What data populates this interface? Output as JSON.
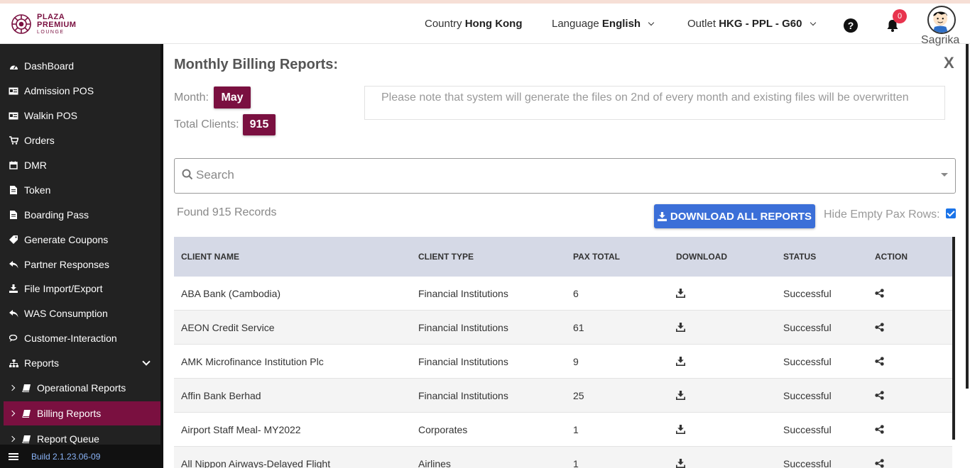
{
  "header": {
    "logo": {
      "line1": "PLAZA",
      "line2": "PREMIUM",
      "line3": "LOUNGE"
    },
    "country": {
      "label": "Country",
      "value": "Hong Kong"
    },
    "language": {
      "label": "Language",
      "value": "English"
    },
    "outlet": {
      "label": "Outlet",
      "value": "HKG - PPL - G60"
    },
    "help_icon": "?",
    "notifications": {
      "icon": "bell-icon",
      "count": "0"
    },
    "user": {
      "name": "Sagrika",
      "avatar_icon": "avatar-icon"
    }
  },
  "sidebar": {
    "items": [
      {
        "label": "DashBoard",
        "icon": "dashboard-icon"
      },
      {
        "label": "Admission POS",
        "icon": "id-card-icon"
      },
      {
        "label": "Walkin POS",
        "icon": "id-card-icon"
      },
      {
        "label": "Orders",
        "icon": "cart-icon"
      },
      {
        "label": "DMR",
        "icon": "calendar-icon"
      },
      {
        "label": "Token",
        "icon": "file-icon"
      },
      {
        "label": "Boarding Pass",
        "icon": "file-icon"
      },
      {
        "label": "Generate Coupons",
        "icon": "tag-icon"
      },
      {
        "label": "Partner Responses",
        "icon": "reply-icon"
      },
      {
        "label": "File Import/Export",
        "icon": "download-icon"
      },
      {
        "label": "WAS Consumption",
        "icon": "reply-all-icon"
      },
      {
        "label": "Customer-Interaction",
        "icon": "comments-icon"
      },
      {
        "label": "Reports",
        "icon": "sitemap-icon"
      }
    ],
    "sub_items": [
      {
        "label": "Operational Reports",
        "icon": "book-icon"
      },
      {
        "label": "Billing Reports",
        "icon": "book-icon",
        "active": true
      },
      {
        "label": "Report Queue",
        "icon": "book-icon"
      }
    ],
    "build": "Build 2.1.23.06-09"
  },
  "main": {
    "title": "Monthly Billing Reports:",
    "close": "X",
    "month_label": "Month:",
    "month_value": "May",
    "clients_label": "Total Clients:",
    "clients_value": "915",
    "note": "Please note that system will generate the files on 2nd of every month and existing files will be overwritten",
    "search_placeholder": "Search",
    "found": "Found 915 Records",
    "download_all": "DOWNLOAD ALL REPORTS",
    "hide_empty_label": "Hide Empty Pax Rows:",
    "hide_empty_checked": true,
    "columns": [
      "CLIENT NAME",
      "CLIENT TYPE",
      "PAX TOTAL",
      "DOWNLOAD",
      "STATUS",
      "ACTION"
    ],
    "rows": [
      {
        "name": "ABA Bank (Cambodia)",
        "type": "Financial Institutions",
        "pax": "6",
        "status": "Successful"
      },
      {
        "name": "AEON Credit Service",
        "type": "Financial Institutions",
        "pax": "61",
        "status": "Successful"
      },
      {
        "name": "AMK Microfinance Institution Plc",
        "type": "Financial Institutions",
        "pax": "9",
        "status": "Successful"
      },
      {
        "name": "Affin Bank Berhad",
        "type": "Financial Institutions",
        "pax": "25",
        "status": "Successful"
      },
      {
        "name": "Airport Staff Meal- MY2022",
        "type": "Corporates",
        "pax": "1",
        "status": "Successful"
      },
      {
        "name": "All Nippon Airways-Delayed Flight",
        "type": "Airlines",
        "pax": "1",
        "status": "Successful"
      }
    ]
  },
  "colors": {
    "brand": "#7a1040",
    "sidebar_bg": "#222222",
    "button_blue": "#3b6fd8",
    "table_header": "#d5d9e6",
    "badge_red": "#e8344e"
  }
}
